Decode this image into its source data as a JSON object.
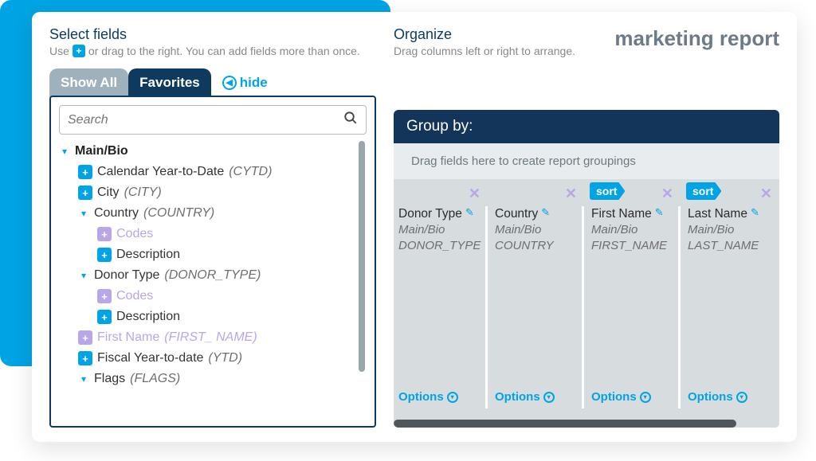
{
  "report_title": "marketing report",
  "left": {
    "title": "Select fields",
    "sub_prefix": "Use",
    "sub_suffix": "or drag to the right. You can add fields more than once.",
    "tabs": {
      "inactive": "Show All",
      "active": "Favorites"
    },
    "hide": "hide",
    "search_placeholder": "Search"
  },
  "right": {
    "title": "Organize",
    "sub": "Drag columns left or right to arrange.",
    "groupby_label": "Group by:",
    "groupby_hint": "Drag fields here to create report groupings",
    "sort_label": "sort",
    "options_label": "Options"
  },
  "tree": {
    "root": {
      "label": "Main/Bio"
    },
    "cytd": {
      "label": "Calendar Year-to-Date",
      "code": "(CYTD)"
    },
    "city": {
      "label": "City",
      "code": "(CITY)"
    },
    "country": {
      "label": "Country",
      "code": "(COUNTRY)"
    },
    "country_codes": "Codes",
    "country_desc": "Description",
    "donor_type": {
      "label": "Donor Type",
      "code": "(DONOR_TYPE)"
    },
    "donor_codes": "Codes",
    "donor_desc": "Description",
    "first_name": {
      "label": "First Name",
      "code": "(FIRST_ NAME)"
    },
    "fiscal_ytd": {
      "label": "Fiscal Year-to-date",
      "code": "(YTD)"
    },
    "flags": {
      "label": "Flags",
      "code": "(FLAGS)"
    }
  },
  "columns": [
    {
      "title": "Donor Type",
      "sub1": "Main/Bio",
      "sub2": "DONOR_TYPE",
      "sort": false
    },
    {
      "title": "Country",
      "sub1": "Main/Bio",
      "sub2": "COUNTRY",
      "sort": false
    },
    {
      "title": "First Name",
      "sub1": "Main/Bio",
      "sub2": "FIRST_NAME",
      "sort": true
    },
    {
      "title": "Last Name",
      "sub1": "Main/Bio",
      "sub2": "LAST_NAME",
      "sort": true
    }
  ]
}
